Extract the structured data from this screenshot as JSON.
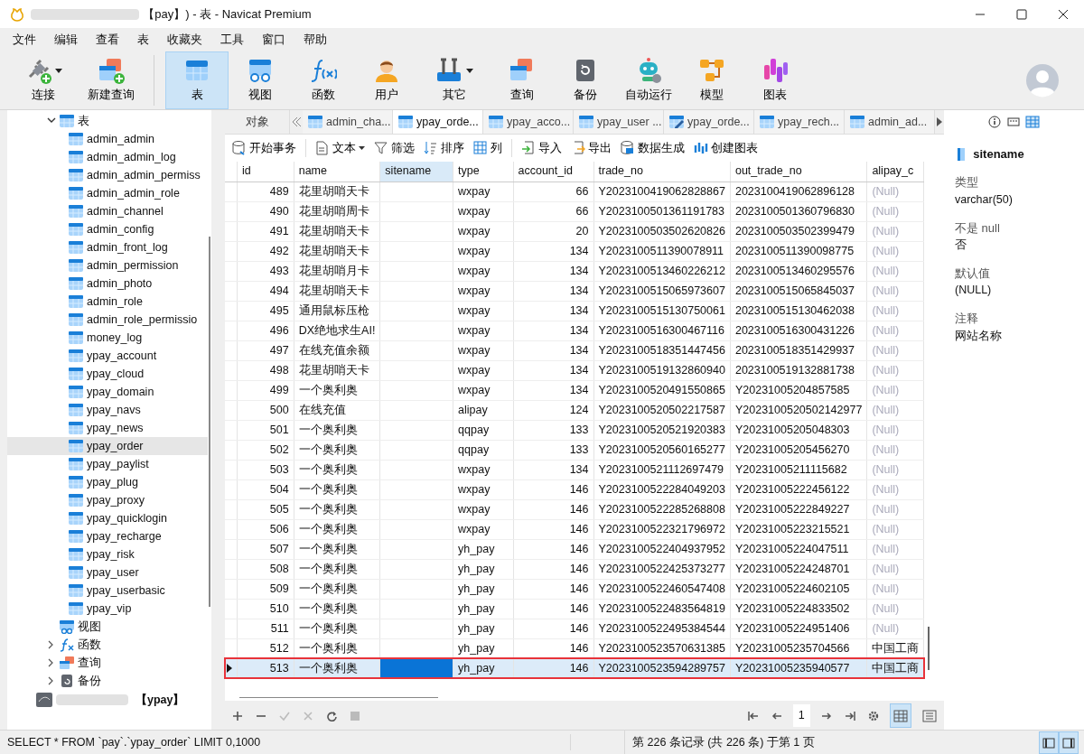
{
  "window": {
    "title": "【pay】) - 表 - Navicat Premium"
  },
  "menu": [
    "文件",
    "编辑",
    "查看",
    "表",
    "收藏夹",
    "工具",
    "窗口",
    "帮助"
  ],
  "toolbar": [
    {
      "label": "连接",
      "dropdown": true,
      "selected": false
    },
    {
      "label": "新建查询",
      "dropdown": false,
      "selected": false
    },
    {
      "label": "表",
      "dropdown": false,
      "selected": true
    },
    {
      "label": "视图",
      "dropdown": false,
      "selected": false
    },
    {
      "label": "函数",
      "dropdown": false,
      "selected": false
    },
    {
      "label": "用户",
      "dropdown": false,
      "selected": false
    },
    {
      "label": "其它",
      "dropdown": true,
      "selected": false
    },
    {
      "label": "查询",
      "dropdown": false,
      "selected": false
    },
    {
      "label": "备份",
      "dropdown": false,
      "selected": false
    },
    {
      "label": "自动运行",
      "dropdown": false,
      "selected": false
    },
    {
      "label": "模型",
      "dropdown": false,
      "selected": false
    },
    {
      "label": "图表",
      "dropdown": false,
      "selected": false
    }
  ],
  "sidebar": {
    "items": [
      {
        "label": "表",
        "kind": "tables",
        "expanded": true,
        "children": [
          {
            "label": "admin_admin",
            "selected": false
          },
          {
            "label": "admin_admin_log",
            "selected": false
          },
          {
            "label": "admin_admin_permiss",
            "selected": false
          },
          {
            "label": "admin_admin_role",
            "selected": false
          },
          {
            "label": "admin_channel",
            "selected": false
          },
          {
            "label": "admin_config",
            "selected": false
          },
          {
            "label": "admin_front_log",
            "selected": false
          },
          {
            "label": "admin_permission",
            "selected": false
          },
          {
            "label": "admin_photo",
            "selected": false
          },
          {
            "label": "admin_role",
            "selected": false
          },
          {
            "label": "admin_role_permissio",
            "selected": false
          },
          {
            "label": "money_log",
            "selected": false
          },
          {
            "label": "ypay_account",
            "selected": false
          },
          {
            "label": "ypay_cloud",
            "selected": false
          },
          {
            "label": "ypay_domain",
            "selected": false
          },
          {
            "label": "ypay_navs",
            "selected": false
          },
          {
            "label": "ypay_news",
            "selected": false
          },
          {
            "label": "ypay_order",
            "selected": true
          },
          {
            "label": "ypay_paylist",
            "selected": false
          },
          {
            "label": "ypay_plug",
            "selected": false
          },
          {
            "label": "ypay_proxy",
            "selected": false
          },
          {
            "label": "ypay_quicklogin",
            "selected": false
          },
          {
            "label": "ypay_recharge",
            "selected": false
          },
          {
            "label": "ypay_risk",
            "selected": false
          },
          {
            "label": "ypay_user",
            "selected": false
          },
          {
            "label": "ypay_userbasic",
            "selected": false
          },
          {
            "label": "ypay_vip",
            "selected": false
          }
        ]
      },
      {
        "label": "视图",
        "kind": "views"
      },
      {
        "label": "函数",
        "kind": "functions",
        "expanded": false
      },
      {
        "label": "查询",
        "kind": "queries",
        "expanded": false
      },
      {
        "label": "备份",
        "kind": "backups",
        "expanded": false
      }
    ],
    "connection": {
      "label": "【ypay】"
    }
  },
  "objects_tab": {
    "label": "对象"
  },
  "tabs": [
    {
      "label": "admin_cha...",
      "kind": "table",
      "selected": false
    },
    {
      "label": "ypay_orde...",
      "kind": "table",
      "selected": true
    },
    {
      "label": "ypay_acco...",
      "kind": "table",
      "selected": false
    },
    {
      "label": "ypay_user ...",
      "kind": "table",
      "selected": false
    },
    {
      "label": "ypay_orde...",
      "kind": "edit",
      "selected": false
    },
    {
      "label": "ypay_rech...",
      "kind": "table",
      "selected": false
    },
    {
      "label": "admin_ad...",
      "kind": "table",
      "selected": false
    }
  ],
  "data_toolbar": [
    {
      "label": "开始事务",
      "dropdown": false
    },
    {
      "label": "文本",
      "dropdown": true
    },
    {
      "label": "筛选",
      "dropdown": false
    },
    {
      "label": "排序",
      "dropdown": false
    },
    {
      "label": "列",
      "dropdown": false
    },
    {
      "label": "导入",
      "dropdown": false
    },
    {
      "label": "导出",
      "dropdown": false
    },
    {
      "label": "数据生成",
      "dropdown": false
    },
    {
      "label": "创建图表",
      "dropdown": false
    }
  ],
  "table": {
    "columns": [
      {
        "label": "id",
        "numeric": true,
        "selected": false
      },
      {
        "label": "name",
        "numeric": false,
        "selected": false
      },
      {
        "label": "sitename",
        "numeric": false,
        "selected": true
      },
      {
        "label": "type",
        "numeric": false,
        "selected": false
      },
      {
        "label": "account_id",
        "numeric": true,
        "selected": false
      },
      {
        "label": "trade_no",
        "numeric": false,
        "selected": false
      },
      {
        "label": "out_trade_no",
        "numeric": false,
        "selected": false
      },
      {
        "label": "alipay_c",
        "numeric": false,
        "selected": false
      }
    ],
    "rows": [
      {
        "cells": [
          "489",
          "花里胡哨天卡",
          "",
          "wxpay",
          "66",
          "Y2023100419062828867",
          "2023100419062896128",
          "(Null)"
        ],
        "null_last": true,
        "selected": false,
        "outlined": false
      },
      {
        "cells": [
          "490",
          "花里胡哨周卡",
          "",
          "wxpay",
          "66",
          "Y2023100501361191783",
          "2023100501360796830",
          "(Null)"
        ],
        "null_last": true,
        "selected": false,
        "outlined": false
      },
      {
        "cells": [
          "491",
          "花里胡哨天卡",
          "",
          "wxpay",
          "20",
          "Y2023100503502620826",
          "2023100503502399479",
          "(Null)"
        ],
        "null_last": true,
        "selected": false,
        "outlined": false
      },
      {
        "cells": [
          "492",
          "花里胡哨天卡",
          "",
          "wxpay",
          "134",
          "Y2023100511390078911",
          "2023100511390098775",
          "(Null)"
        ],
        "null_last": true,
        "selected": false,
        "outlined": false
      },
      {
        "cells": [
          "493",
          "花里胡哨月卡",
          "",
          "wxpay",
          "134",
          "Y2023100513460226212",
          "2023100513460295576",
          "(Null)"
        ],
        "null_last": true,
        "selected": false,
        "outlined": false
      },
      {
        "cells": [
          "494",
          "花里胡哨天卡",
          "",
          "wxpay",
          "134",
          "Y2023100515065973607",
          "2023100515065845037",
          "(Null)"
        ],
        "null_last": true,
        "selected": false,
        "outlined": false
      },
      {
        "cells": [
          "495",
          "通用鼠标压枪",
          "",
          "wxpay",
          "134",
          "Y2023100515130750061",
          "2023100515130462038",
          "(Null)"
        ],
        "null_last": true,
        "selected": false,
        "outlined": false
      },
      {
        "cells": [
          "496",
          "DX绝地求生AI!",
          "",
          "wxpay",
          "134",
          "Y2023100516300467116",
          "2023100516300431226",
          "(Null)"
        ],
        "null_last": true,
        "selected": false,
        "outlined": false
      },
      {
        "cells": [
          "497",
          "在线充值余额",
          "",
          "wxpay",
          "134",
          "Y2023100518351447456",
          "2023100518351429937",
          "(Null)"
        ],
        "null_last": true,
        "selected": false,
        "outlined": false
      },
      {
        "cells": [
          "498",
          "花里胡哨天卡",
          "",
          "wxpay",
          "134",
          "Y2023100519132860940",
          "2023100519132881738",
          "(Null)"
        ],
        "null_last": true,
        "selected": false,
        "outlined": false
      },
      {
        "cells": [
          "499",
          "一个奥利奥",
          "",
          "wxpay",
          "134",
          "Y2023100520491550865",
          "Y20231005204857585",
          "(Null)"
        ],
        "null_last": true,
        "selected": false,
        "outlined": false
      },
      {
        "cells": [
          "500",
          "在线充值",
          "",
          "alipay",
          "124",
          "Y2023100520502217587",
          "Y2023100520502142977",
          "(Null)"
        ],
        "null_last": true,
        "selected": false,
        "outlined": false
      },
      {
        "cells": [
          "501",
          "一个奥利奥",
          "",
          "qqpay",
          "133",
          "Y2023100520521920383",
          "Y20231005205048303",
          "(Null)"
        ],
        "null_last": true,
        "selected": false,
        "outlined": false
      },
      {
        "cells": [
          "502",
          "一个奥利奥",
          "",
          "qqpay",
          "133",
          "Y2023100520560165277",
          "Y20231005205456270",
          "(Null)"
        ],
        "null_last": true,
        "selected": false,
        "outlined": false
      },
      {
        "cells": [
          "503",
          "一个奥利奥",
          "",
          "wxpay",
          "134",
          "Y2023100521112697479",
          "Y20231005211115682",
          "(Null)"
        ],
        "null_last": true,
        "selected": false,
        "outlined": false
      },
      {
        "cells": [
          "504",
          "一个奥利奥",
          "",
          "wxpay",
          "146",
          "Y2023100522284049203",
          "Y20231005222456122",
          "(Null)"
        ],
        "null_last": true,
        "selected": false,
        "outlined": false
      },
      {
        "cells": [
          "505",
          "一个奥利奥",
          "",
          "wxpay",
          "146",
          "Y2023100522285268808",
          "Y20231005222849227",
          "(Null)"
        ],
        "null_last": true,
        "selected": false,
        "outlined": false
      },
      {
        "cells": [
          "506",
          "一个奥利奥",
          "",
          "wxpay",
          "146",
          "Y2023100522321796972",
          "Y20231005223215521",
          "(Null)"
        ],
        "null_last": true,
        "selected": false,
        "outlined": false
      },
      {
        "cells": [
          "507",
          "一个奥利奥",
          "",
          "yh_pay",
          "146",
          "Y2023100522404937952",
          "Y20231005224047511",
          "(Null)"
        ],
        "null_last": true,
        "selected": false,
        "outlined": false
      },
      {
        "cells": [
          "508",
          "一个奥利奥",
          "",
          "yh_pay",
          "146",
          "Y2023100522425373277",
          "Y20231005224248701",
          "(Null)"
        ],
        "null_last": true,
        "selected": false,
        "outlined": false
      },
      {
        "cells": [
          "509",
          "一个奥利奥",
          "",
          "yh_pay",
          "146",
          "Y2023100522460547408",
          "Y20231005224602105",
          "(Null)"
        ],
        "null_last": true,
        "selected": false,
        "outlined": false
      },
      {
        "cells": [
          "510",
          "一个奥利奥",
          "",
          "yh_pay",
          "146",
          "Y2023100522483564819",
          "Y20231005224833502",
          "(Null)"
        ],
        "null_last": true,
        "selected": false,
        "outlined": false
      },
      {
        "cells": [
          "511",
          "一个奥利奥",
          "",
          "yh_pay",
          "146",
          "Y2023100522495384544",
          "Y20231005224951406",
          "(Null)"
        ],
        "null_last": true,
        "selected": false,
        "outlined": false
      },
      {
        "cells": [
          "512",
          "一个奥利奥",
          "",
          "yh_pay",
          "146",
          "Y2023100523570631385",
          "Y20231005235704566",
          "中国工商"
        ],
        "null_last": false,
        "selected": false,
        "outlined": false
      },
      {
        "cells": [
          "513",
          "一个奥利奥",
          "",
          "yh_pay",
          "146",
          "Y2023100523594289757",
          "Y20231005235940577",
          "中国工商"
        ],
        "null_last": false,
        "selected": true,
        "outlined": true
      }
    ]
  },
  "pager": {
    "page": "1"
  },
  "details": {
    "field": "sitename",
    "properties": [
      {
        "label": "类型",
        "value": "varchar(50)"
      },
      {
        "label": "不是 null",
        "value": "否"
      },
      {
        "label": "默认值",
        "value": "(NULL)"
      },
      {
        "label": "注释",
        "value": "网站名称"
      }
    ]
  },
  "status_bar": {
    "sql": "SELECT * FROM `pay`.`ypay_order` LIMIT 0,1000",
    "records": "第 226 条记录 (共 226 条) 于第 1 页"
  }
}
